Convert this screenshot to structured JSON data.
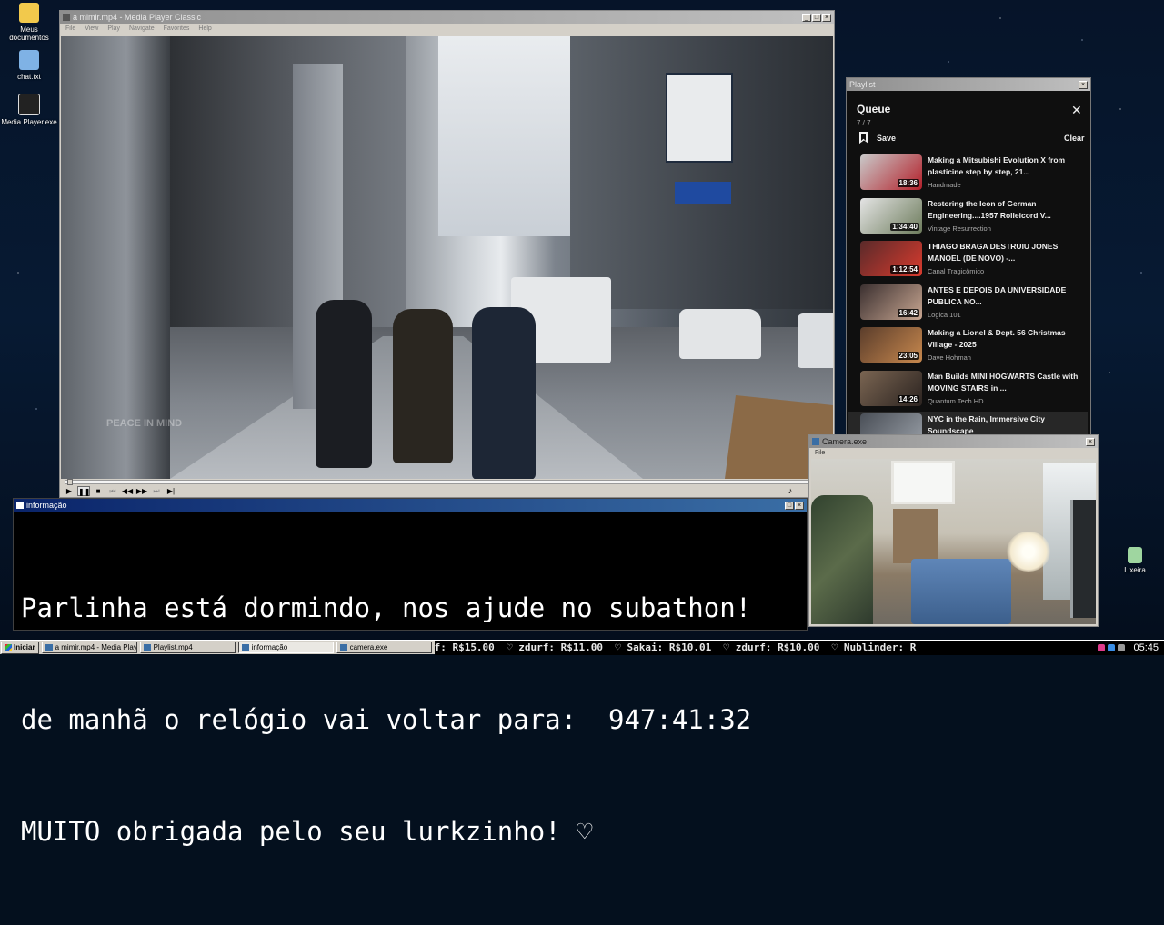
{
  "desktop": {
    "icons": [
      {
        "label": "Meus documentos",
        "icon": "folder-icon",
        "color": "#f2c94c"
      },
      {
        "label": "chat.txt",
        "icon": "notepad-icon",
        "color": "#7fb2e5"
      },
      {
        "label": "Media Player.exe",
        "icon": "film-icon",
        "color": "#222222"
      },
      {
        "label": "Lixeira",
        "icon": "recycle-bin-icon",
        "color": "#9fd6a0"
      }
    ]
  },
  "media_player": {
    "title": "a mimir.mp4 - Media Player Classic",
    "menu": [
      "File",
      "View",
      "Play",
      "Navigate",
      "Favorites",
      "Help"
    ],
    "watermark": "PEACE IN MIND",
    "controls": [
      "play",
      "pause",
      "stop",
      "prev",
      "rewind",
      "forward",
      "next",
      "frame-step"
    ],
    "position_fraction": 0.0
  },
  "playlist": {
    "window_title": "Playlist",
    "heading": "Queue",
    "count": "7 / 7",
    "save_label": "Save",
    "clear_label": "Clear",
    "items": [
      {
        "title": "Making a Mitsubishi Evolution X from plasticine step by step, 21...",
        "channel": "Handmade",
        "duration": "18:36",
        "colors": [
          "#c9c9c9",
          "#b3202a"
        ]
      },
      {
        "title": "Restoring the Icon of German Engineering....1957 Rolleicord V...",
        "channel": "Vintage Resurrection",
        "duration": "1:34:40",
        "colors": [
          "#e4e4e4",
          "#6d7c5c"
        ]
      },
      {
        "title": "THIAGO BRAGA DESTRUIU JONES MANOEL (DE NOVO) -...",
        "channel": "Canal Tragicômico",
        "duration": "1:12:54",
        "colors": [
          "#5a2a2a",
          "#d93b2e"
        ]
      },
      {
        "title": "ANTES E DEPOIS DA UNIVERSIDADE PUBLICA NO...",
        "channel": "Logica 101",
        "duration": "16:42",
        "colors": [
          "#3b3030",
          "#c8a691"
        ]
      },
      {
        "title": "Making a Lionel & Dept. 56 Christmas Village - 2025",
        "channel": "Dave Hohman",
        "duration": "23:05",
        "colors": [
          "#5b3d2b",
          "#c7884e"
        ]
      },
      {
        "title": "Man Builds MINI HOGWARTS Castle with MOVING STAIRS in ...",
        "channel": "Quantum Tech HD",
        "duration": "14:26",
        "colors": [
          "#7a6552",
          "#2b2320"
        ]
      },
      {
        "title": "NYC in the Rain, Immersive City Soundscape",
        "channel": "",
        "duration": "",
        "colors": [
          "#4a4f57",
          "#9aa0a8"
        ]
      }
    ]
  },
  "camera": {
    "title": "Camera.exe",
    "menu": [
      "File"
    ]
  },
  "info": {
    "title": "informação",
    "lines": [
      "Parlinha está dormindo, nos ajude no subathon!",
      "de manhã o relógio vai voltar para:  947:41:32",
      "MUITO obrigada pelo seu lurkzinho! ♡"
    ]
  },
  "taskbar": {
    "start_label": "Iniciar",
    "tasks": [
      {
        "label": "a mimir.mp4 - Media Playe...",
        "active": false
      },
      {
        "label": "Playlist.mp4",
        "active": false
      },
      {
        "label": "informação",
        "active": true
      },
      {
        "label": "camera.exe",
        "active": false
      }
    ],
    "ticker": "f: R$15.00  ♡ zdurf: R$11.00  ♡ Sakai: R$10.01  ♡ zdurf: R$10.00  ♡ Nublinder: R",
    "clock": "05:45"
  }
}
